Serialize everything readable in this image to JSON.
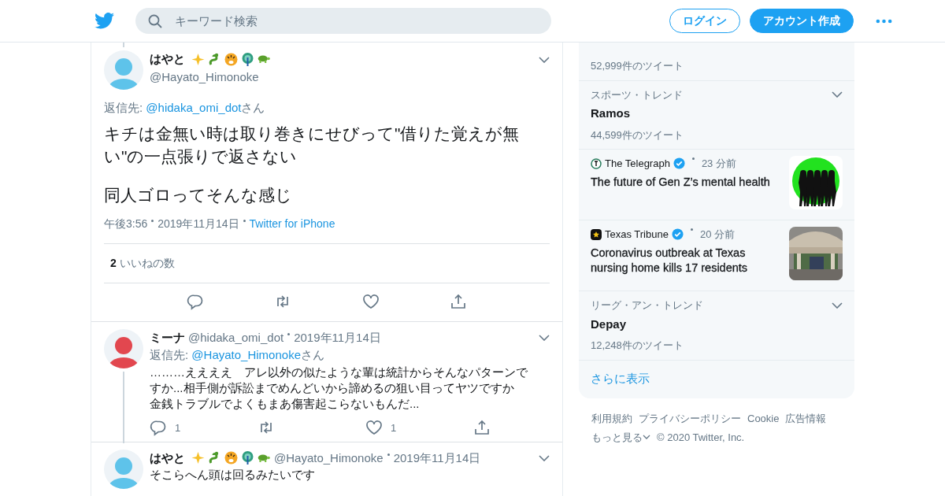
{
  "header": {
    "search_placeholder": "キーワード検索",
    "login": "ログイン",
    "signup": "アカウント作成"
  },
  "main_tweet": {
    "name": "はやと",
    "handle": "@Hayato_Himonoke",
    "reply_label": "返信先:",
    "reply_to": "@hidaka_omi_dot",
    "reply_suffix": "さん",
    "paragraphs": [
      "キチは金無い時は取り巻きにせびって\"借りた覚えが無い\"の一点張りで返さない",
      "同人ゴロってそんな感じ"
    ],
    "time": "午後3:56",
    "date": "2019年11月14日",
    "source": "Twitter for iPhone",
    "likes_count": "2",
    "likes_label": "いいねの数"
  },
  "replies": [
    {
      "name": "ミーナ",
      "handle": "@hidaka_omi_dot",
      "date": "2019年11月14日",
      "color": "#e2474f",
      "emoji": false,
      "thread": true,
      "reply_label": "返信先:",
      "reply_to": "@Hayato_Himonoke",
      "reply_suffix": "さん",
      "lines": [
        "………ええええ　アレ以外の似たような輩は統計からそんなパターンですか...相手側が訴訟までめんどいから諦めるの狙い目ってヤツですか",
        "金銭トラブルでよくもまあ傷害起こらないもんだ..."
      ],
      "reply_count": "1",
      "like_count": "1"
    },
    {
      "name": "はやと",
      "handle": "@Hayato_Himonoke",
      "date": "2019年11月14日",
      "color": "#5ec3ea",
      "emoji": true,
      "thread": false,
      "lines": [
        "そこらへん頭は回るみたいです"
      ]
    }
  ],
  "sidebar": {
    "items": [
      {
        "kind": "trend",
        "count": "52,999件のツイート"
      },
      {
        "kind": "trend",
        "context": "スポーツ・トレンド",
        "title": "Ramos",
        "count": "44,599件のツイート"
      },
      {
        "kind": "news",
        "source": "The Telegraph",
        "time": "23 分前",
        "headline": "The future of Gen Z’s mental health"
      },
      {
        "kind": "news",
        "source": "Texas Tribune",
        "time": "20 分前",
        "headline": "Coronavirus outbreak at Texas nursing home kills 17 residents"
      },
      {
        "kind": "trend",
        "context": "リーグ・アン・トレンド",
        "title": "Depay",
        "count": "12,248件のツイート"
      }
    ],
    "show_more": "さらに表示"
  },
  "footer": {
    "links": [
      "利用規約",
      "プライバシーポリシー",
      "Cookie",
      "広告情報"
    ],
    "more": "もっと見る",
    "copyright": "© 2020 Twitter, Inc."
  }
}
